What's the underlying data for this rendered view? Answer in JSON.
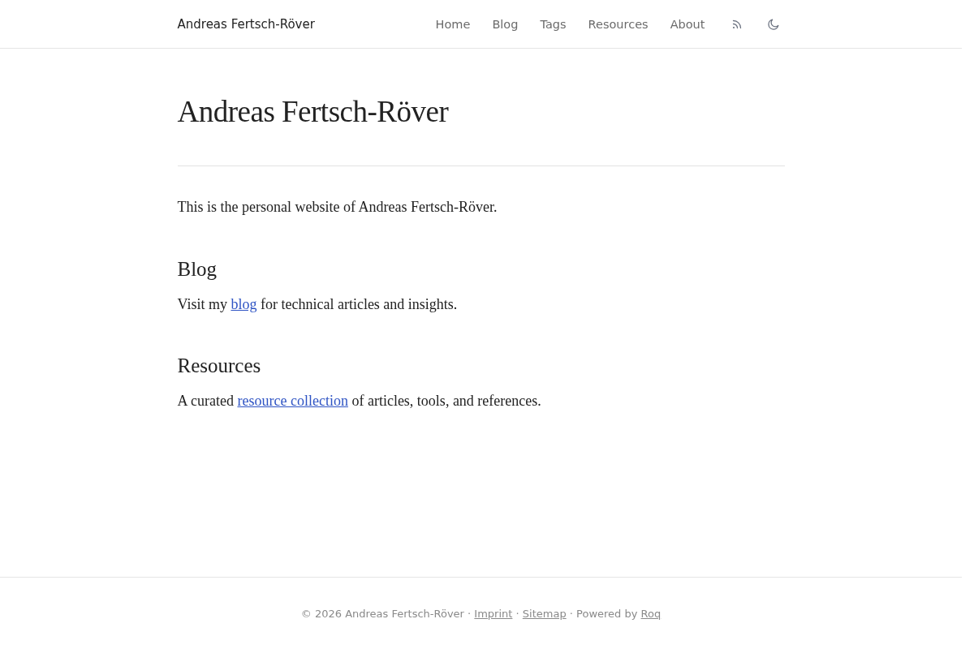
{
  "header": {
    "brand": "Andreas Fertsch-Röver",
    "nav": [
      {
        "label": "Home"
      },
      {
        "label": "Blog"
      },
      {
        "label": "Tags"
      },
      {
        "label": "Resources"
      },
      {
        "label": "About"
      }
    ]
  },
  "page": {
    "title": "Andreas Fertsch-Röver",
    "intro": "This is the personal website of Andreas Fertsch-Röver.",
    "sections": [
      {
        "heading": "Blog",
        "text": [
          {
            "kind": "text",
            "text": "Visit my "
          },
          {
            "kind": "link",
            "text": "blog"
          },
          {
            "kind": "text",
            "text": " for technical articles and insights."
          }
        ]
      },
      {
        "heading": "Resources",
        "text": [
          {
            "kind": "text",
            "text": "A curated "
          },
          {
            "kind": "link",
            "text": "resource collection"
          },
          {
            "kind": "text",
            "text": " of articles, tools, and references."
          }
        ]
      }
    ]
  },
  "footer": {
    "text": [
      {
        "kind": "text",
        "text": "© 2026 Andreas Fertsch-Röver · "
      },
      {
        "kind": "link",
        "text": "Imprint"
      },
      {
        "kind": "text",
        "text": " · "
      },
      {
        "kind": "link",
        "text": "Sitemap"
      },
      {
        "kind": "text",
        "text": " · Powered by "
      },
      {
        "kind": "link",
        "text": "Roq"
      }
    ]
  }
}
